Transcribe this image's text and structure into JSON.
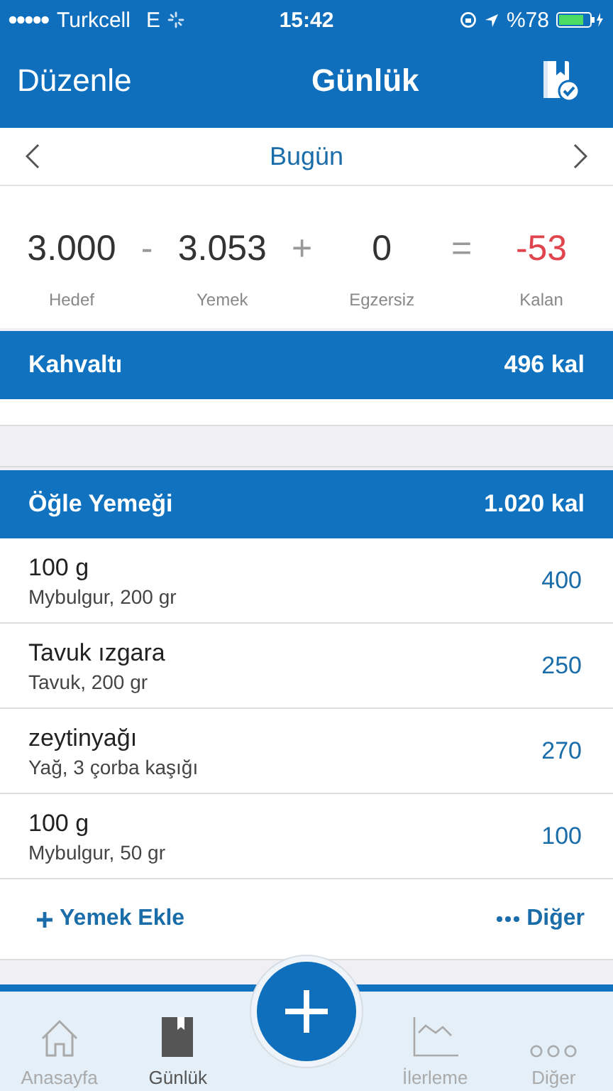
{
  "status_bar": {
    "carrier": "Turkcell",
    "network": "E",
    "time": "15:42",
    "battery": "%78"
  },
  "nav": {
    "left": "Düzenle",
    "title": "Günlük"
  },
  "date_bar": {
    "label": "Bugün"
  },
  "summary": [
    {
      "value": "3.000",
      "label": "Hedef",
      "op": "-",
      "negative": false
    },
    {
      "value": "3.053",
      "label": "Yemek",
      "op": "+",
      "negative": false
    },
    {
      "value": "0",
      "label": "Egzersiz",
      "op": "=",
      "negative": false
    },
    {
      "value": "-53",
      "label": "Kalan",
      "negative": true
    }
  ],
  "meals": [
    {
      "name": "Kahvaltı",
      "total": "496 kal"
    },
    {
      "name": "Öğle Yemeği",
      "total": "1.020 kal",
      "items": [
        {
          "name": "100 g",
          "detail": "Mybulgur, 200 gr",
          "cal": "400"
        },
        {
          "name": "Tavuk ızgara",
          "detail": "Tavuk, 200 gr",
          "cal": "250"
        },
        {
          "name": "zeytinyağı",
          "detail": "Yağ, 3 çorba kaşığı",
          "cal": "270"
        },
        {
          "name": "100 g",
          "detail": "Mybulgur, 50 gr",
          "cal": "100"
        }
      ],
      "add": "Yemek Ekle",
      "more": "Diğer"
    }
  ],
  "tabs": [
    {
      "label": "Anasayfa",
      "kind": "home",
      "selected": false
    },
    {
      "label": "Günlük",
      "kind": "diary",
      "selected": true
    },
    {
      "kind": "add",
      "selected": false
    },
    {
      "label": "İlerleme",
      "kind": "progress",
      "selected": false
    },
    {
      "label": "Diğer",
      "kind": "more",
      "selected": false
    }
  ]
}
